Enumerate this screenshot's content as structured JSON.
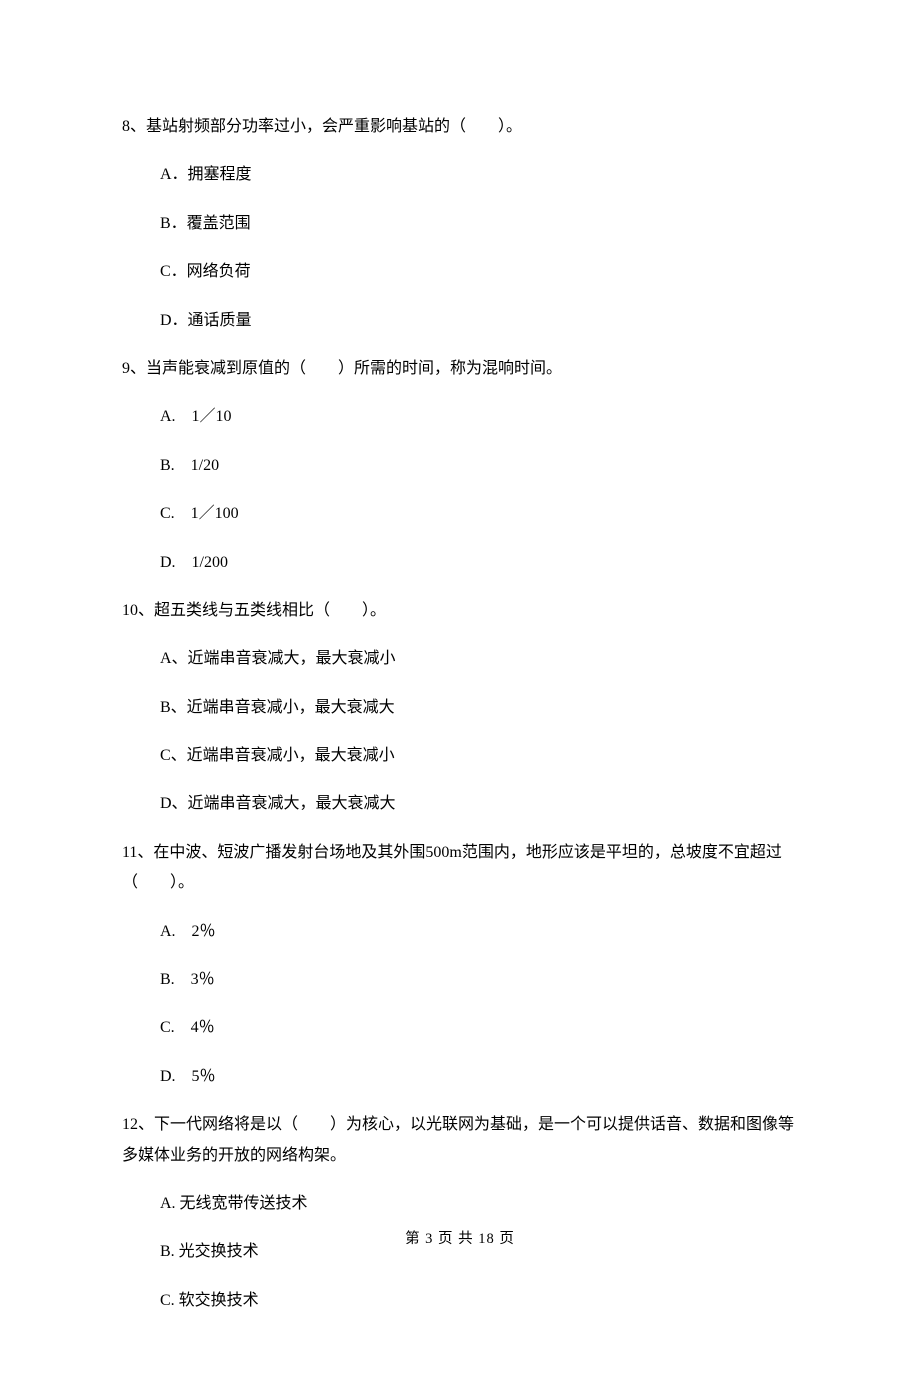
{
  "questions": [
    {
      "stem": "8、基站射频部分功率过小，会严重影响基站的（　　）。",
      "opts": [
        "A．拥塞程度",
        "B．覆盖范围",
        "C．网络负荷",
        "D．通话质量"
      ]
    },
    {
      "stem": "9、当声能衰减到原值的（　　）所需的时间，称为混响时间。",
      "opts": [
        "A.　1／10",
        "B.　1/20",
        "C.　1／100",
        "D.　1/200"
      ]
    },
    {
      "stem": "10、超五类线与五类线相比（　　）。",
      "opts": [
        "A、近端串音衰减大，最大衰减小",
        "B、近端串音衰减小，最大衰减大",
        "C、近端串音衰减小，最大衰减小",
        "D、近端串音衰减大，最大衰减大"
      ]
    },
    {
      "stem": "11、在中波、短波广播发射台场地及其外围500m范围内，地形应该是平坦的，总坡度不宜超过（　　）。",
      "opts": [
        "A.　2％",
        "B.　3％",
        "C.　4％",
        "D.　5％"
      ]
    },
    {
      "stem": "12、下一代网络将是以（　　）为核心，以光联网为基础，是一个可以提供话音、数据和图像等多媒体业务的开放的网络构架。",
      "opts": [
        "A. 无线宽带传送技术",
        "B. 光交换技术",
        "C. 软交换技术"
      ]
    }
  ],
  "footer": "第 3 页 共 18 页"
}
